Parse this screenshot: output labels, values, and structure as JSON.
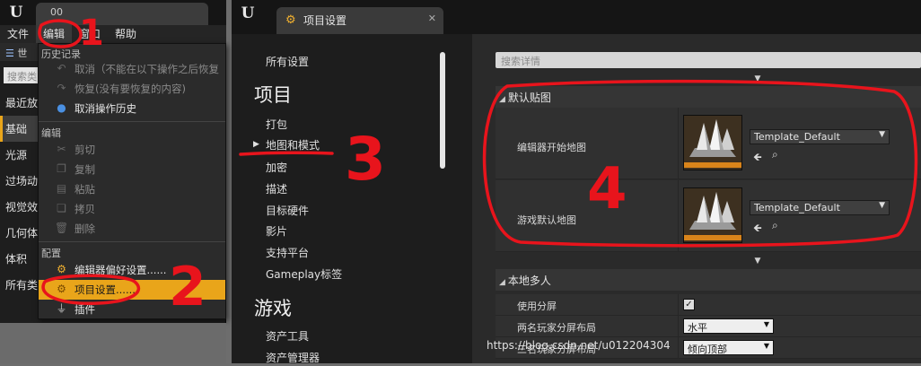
{
  "editor": {
    "tab_title": "00",
    "menu": [
      "文件",
      "编辑",
      "窗口",
      "帮助"
    ],
    "world_label": "世",
    "search_placeholder": "搜索类",
    "categories": [
      "最近放",
      "基础",
      "光源",
      "过场动",
      "视觉效",
      "几何体",
      "体积",
      "所有类"
    ]
  },
  "edit_menu": {
    "history_header": "历史记录",
    "undo": "取消（不能在以下操作之后恢复",
    "redo": "恢复(没有要恢复的内容)",
    "undo_history": "取消操作历史",
    "edit_section": "编辑",
    "cut": "剪切",
    "copy": "复制",
    "paste": "粘贴",
    "duplicate": "拷贝",
    "delete": "删除",
    "config_section": "配置",
    "editor_prefs": "编辑器偏好设置......",
    "project_settings": "项目设置......",
    "plugins": "插件"
  },
  "settings_window": {
    "tab_title": "项目设置",
    "nav": {
      "all_settings": "所有设置",
      "project_header": "项目",
      "project_items": [
        "打包",
        "地图和模式",
        "加密",
        "描述",
        "目标硬件",
        "影片",
        "支持平台",
        "Gameplay标签"
      ],
      "game_header": "游戏",
      "game_items": [
        "资产工具",
        "资产管理器"
      ]
    },
    "details": {
      "search_placeholder": "搜索详情",
      "default_maps_header": "默认贴图",
      "editor_startup_map_label": "编辑器开始地图",
      "editor_startup_map_value": "Template_Default",
      "game_default_map_label": "游戏默认地图",
      "game_default_map_value": "Template_Default",
      "local_multiplayer_header": "本地多人",
      "use_splitscreen_label": "使用分屏",
      "use_splitscreen_checked": true,
      "two_player_layout_label": "两名玩家分屏布局",
      "two_player_layout_value": "水平",
      "three_player_layout_label": "三名玩家分屏布局",
      "three_player_layout_value": "倾向顶部"
    }
  },
  "annotations": {
    "step1": "1",
    "step2": "2",
    "step3": "3",
    "step4": "4",
    "color": "#e8141c"
  },
  "watermark": "https://blog.csdn.net/u012204304",
  "colors": {
    "accent": "#e9a51a",
    "annotation_red": "#e8141c"
  }
}
